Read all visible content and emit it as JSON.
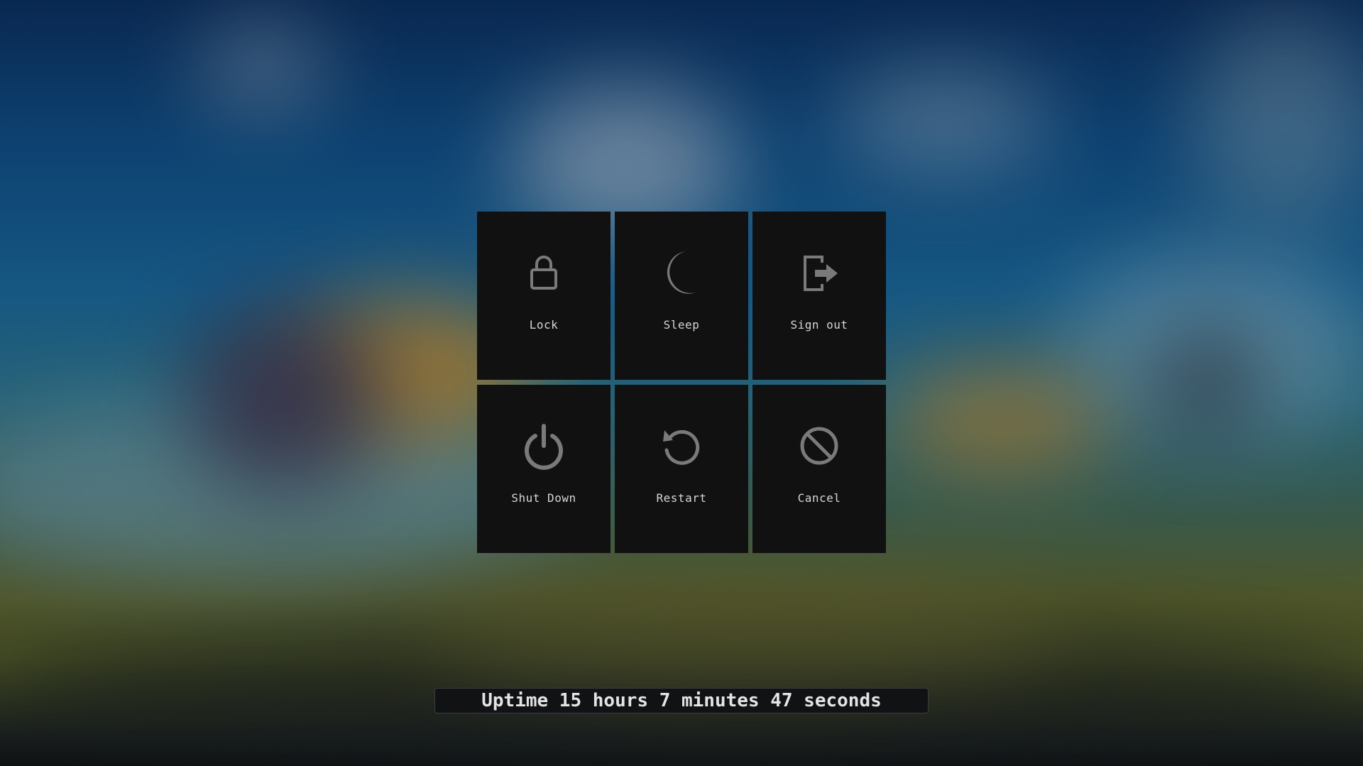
{
  "power_menu": {
    "items": [
      {
        "label": "Lock",
        "icon": "lock-icon"
      },
      {
        "label": "Sleep",
        "icon": "moon-icon"
      },
      {
        "label": "Sign out",
        "icon": "sign-out-icon"
      },
      {
        "label": "Shut Down",
        "icon": "power-icon"
      },
      {
        "label": "Restart",
        "icon": "restart-icon"
      },
      {
        "label": "Cancel",
        "icon": "cancel-icon"
      }
    ]
  },
  "status": {
    "uptime": "Uptime 15 hours 7 minutes 47 seconds"
  },
  "colors": {
    "tile_background": "#111112",
    "icon_color": "#7a7a7a",
    "label_color": "#d6d6d6",
    "wallpaper_sky": "#0f4a80",
    "wallpaper_ground": "#5a6230"
  }
}
